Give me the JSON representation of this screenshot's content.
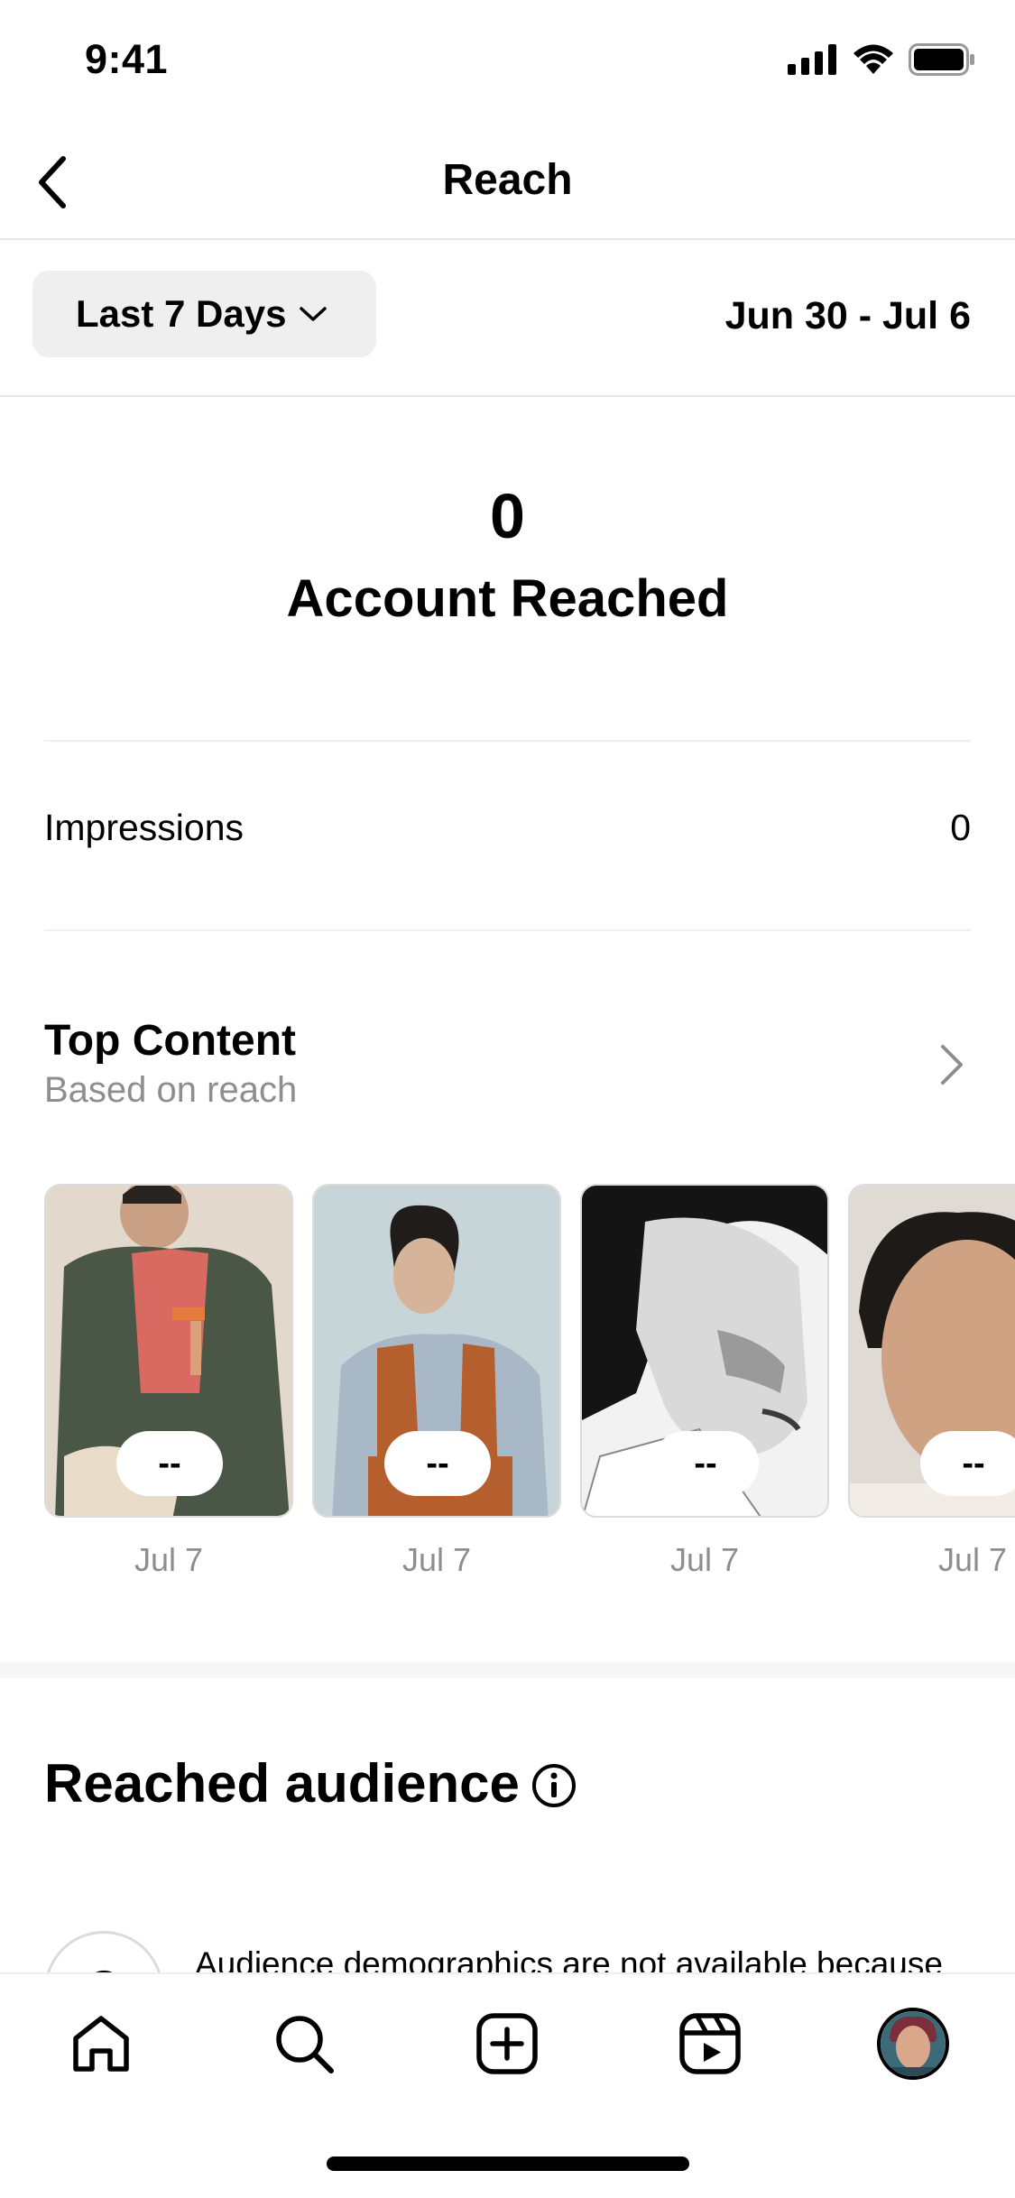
{
  "status_bar": {
    "time": "9:41"
  },
  "header": {
    "title": "Reach"
  },
  "filter": {
    "range_label": "Last 7 Days",
    "date_range": "Jun 30 - Jul 6"
  },
  "summary": {
    "count": "0",
    "label": "Account Reached"
  },
  "metrics": [
    {
      "label": "Impressions",
      "value": "0"
    }
  ],
  "top_content": {
    "title": "Top Content",
    "subtitle": "Based on reach",
    "items": [
      {
        "value": "--",
        "date": "Jul 7"
      },
      {
        "value": "--",
        "date": "Jul 7"
      },
      {
        "value": "--",
        "date": "Jul 7"
      },
      {
        "value": "--",
        "date": "Jul 7"
      }
    ]
  },
  "reached_audience": {
    "title": "Reached audience",
    "demographics_note": "Audience demographics are not available because",
    "avatar_glyph": "?"
  },
  "icons": {
    "back": "chevron-left-icon",
    "dropdown": "chevron-down-icon",
    "more": "chevron-right-icon",
    "info": "info-icon",
    "tabs": [
      "home-icon",
      "search-icon",
      "create-icon",
      "reels-icon",
      "profile-avatar"
    ]
  }
}
